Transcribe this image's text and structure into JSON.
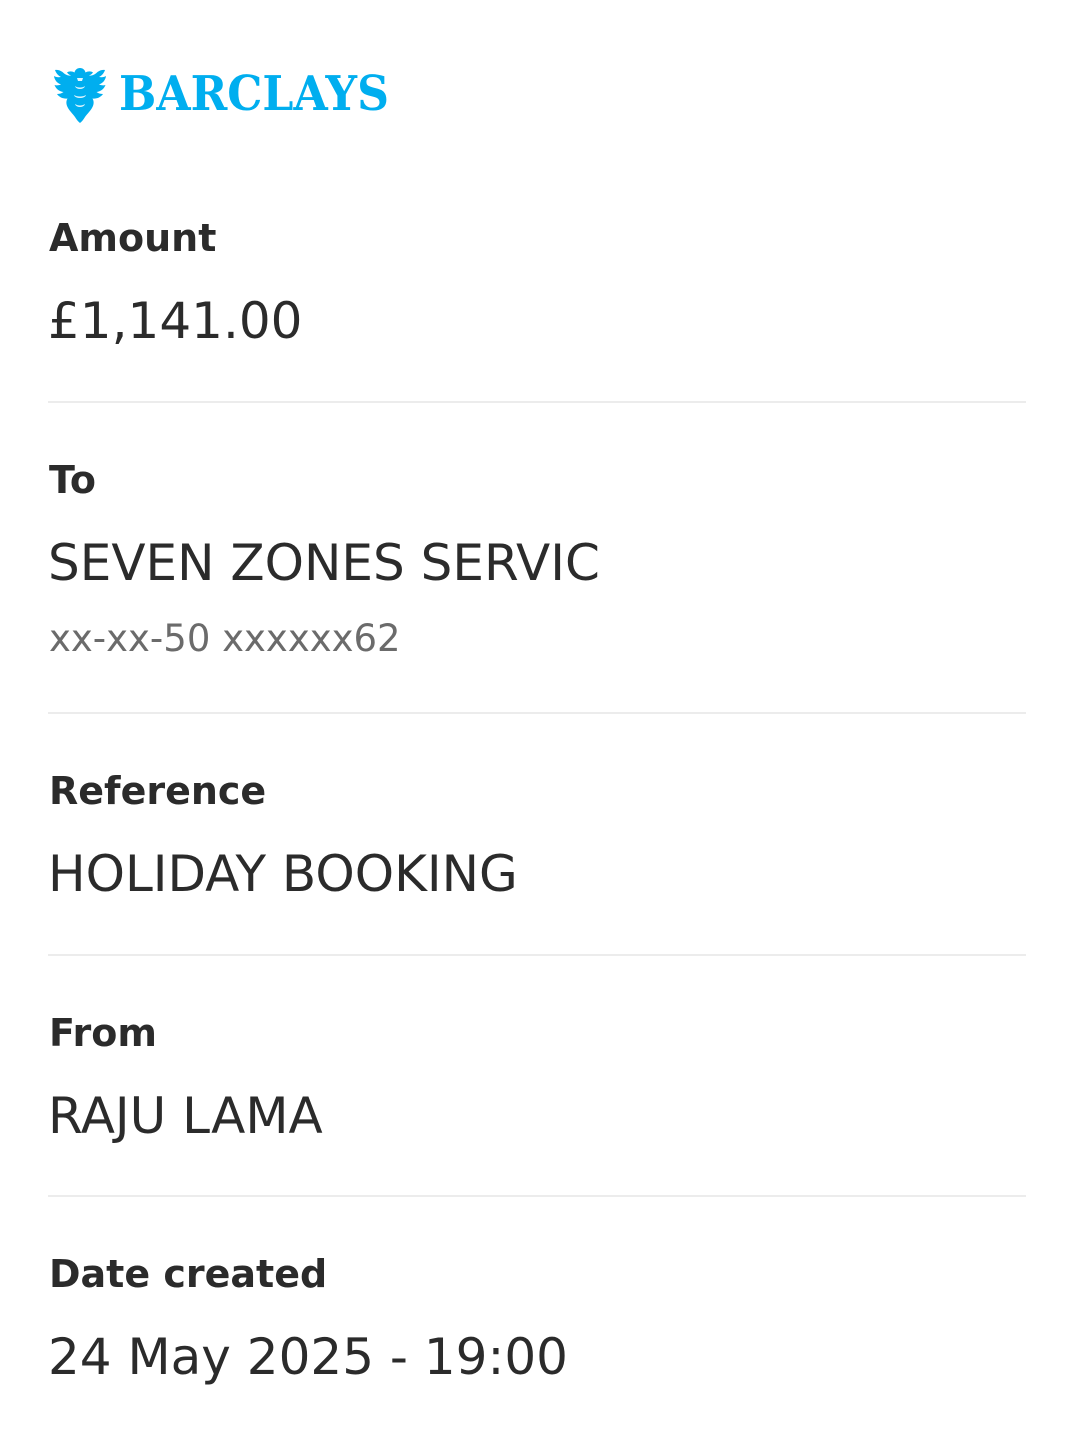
{
  "brand": {
    "name": "BARCLAYS",
    "icon": "eagle-logo-icon",
    "color": "#00aeef"
  },
  "details": {
    "amount": {
      "label": "Amount",
      "value": "£1,141.00"
    },
    "to": {
      "label": "To",
      "name": "SEVEN ZONES SERVIC",
      "account": "xx-xx-50 xxxxxx62"
    },
    "reference": {
      "label": "Reference",
      "value": "HOLIDAY BOOKING"
    },
    "from": {
      "label": "From",
      "value": "RAJU LAMA"
    },
    "date_created": {
      "label": "Date created",
      "value": "24 May 2025 - 19:00"
    }
  }
}
